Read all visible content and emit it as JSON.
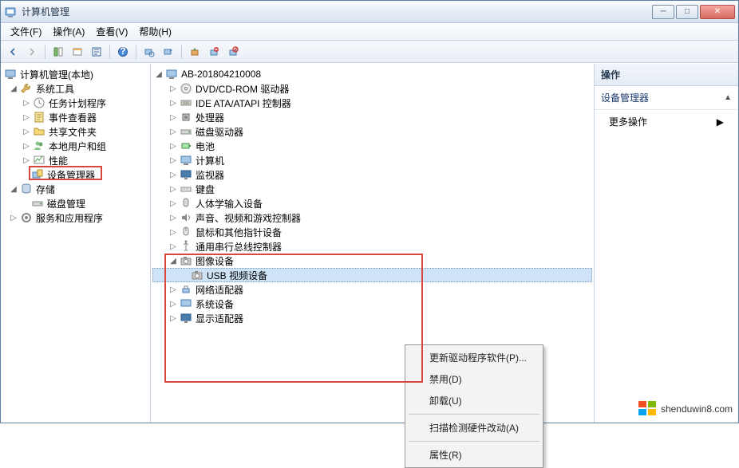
{
  "window": {
    "title": "计算机管理"
  },
  "menu": {
    "file": "文件(F)",
    "action": "操作(A)",
    "view": "查看(V)",
    "help": "帮助(H)"
  },
  "left_tree": {
    "root": "计算机管理(本地)",
    "system_tools": "系统工具",
    "task_scheduler": "任务计划程序",
    "event_viewer": "事件查看器",
    "shared_folders": "共享文件夹",
    "local_users": "本地用户和组",
    "performance": "性能",
    "device_manager": "设备管理器",
    "storage": "存储",
    "disk_mgmt": "磁盘管理",
    "services": "服务和应用程序"
  },
  "device_tree": {
    "root": "AB-201804210008",
    "dvd": "DVD/CD-ROM 驱动器",
    "ide": "IDE ATA/ATAPI 控制器",
    "cpu": "处理器",
    "disk": "磁盘驱动器",
    "battery": "电池",
    "computer": "计算机",
    "monitor": "监视器",
    "keyboard": "键盘",
    "hid": "人体学输入设备",
    "sound": "声音、视频和游戏控制器",
    "mouse": "鼠标和其他指针设备",
    "usb_ctrl": "通用串行总线控制器",
    "imaging": "图像设备",
    "usb_video": "USB 视频设备",
    "network": "网络适配器",
    "system_dev": "系统设备",
    "display": "显示适配器"
  },
  "context_menu": {
    "update": "更新驱动程序软件(P)...",
    "disable": "禁用(D)",
    "uninstall": "卸载(U)",
    "scan": "扫描检测硬件改动(A)",
    "properties": "属性(R)"
  },
  "actions": {
    "header": "操作",
    "section": "设备管理器",
    "more": "更多操作"
  },
  "watermark": "shenduwin8.com"
}
